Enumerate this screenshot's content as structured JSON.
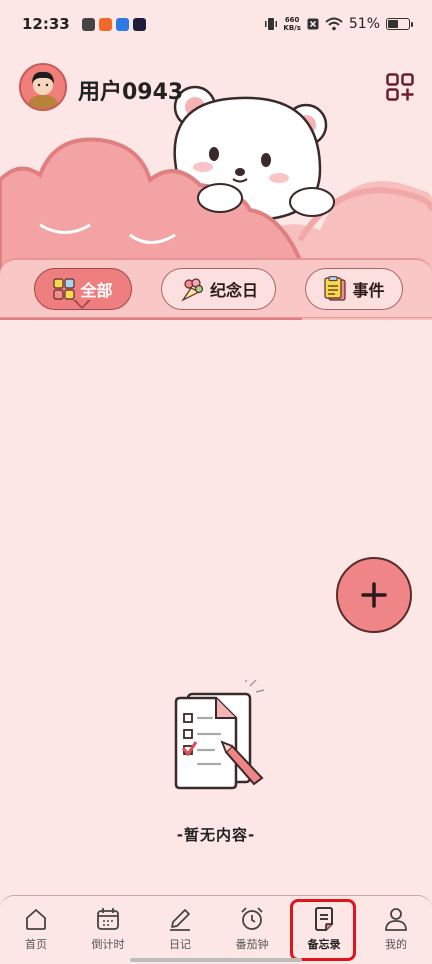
{
  "status_bar": {
    "time": "12:33",
    "net_speed_value": "660",
    "net_speed_unit": "KB/s",
    "battery": "51%"
  },
  "header": {
    "username": "用户0943"
  },
  "tabs": [
    {
      "label": "全部",
      "active": true
    },
    {
      "label": "纪念日",
      "active": false
    },
    {
      "label": "事件",
      "active": false
    }
  ],
  "empty_state": {
    "text": "-暂无内容-"
  },
  "bottom_nav": [
    {
      "label": "首页",
      "icon": "home-icon"
    },
    {
      "label": "倒计时",
      "icon": "calendar-icon"
    },
    {
      "label": "日记",
      "icon": "pencil-icon"
    },
    {
      "label": "番茄钟",
      "icon": "alarm-clock-icon"
    },
    {
      "label": "备忘录",
      "icon": "memo-icon",
      "active": true
    },
    {
      "label": "我的",
      "icon": "person-icon"
    }
  ],
  "colors": {
    "background": "#fde7e6",
    "accent": "#ef7e7e",
    "highlight": "#e0141a"
  }
}
